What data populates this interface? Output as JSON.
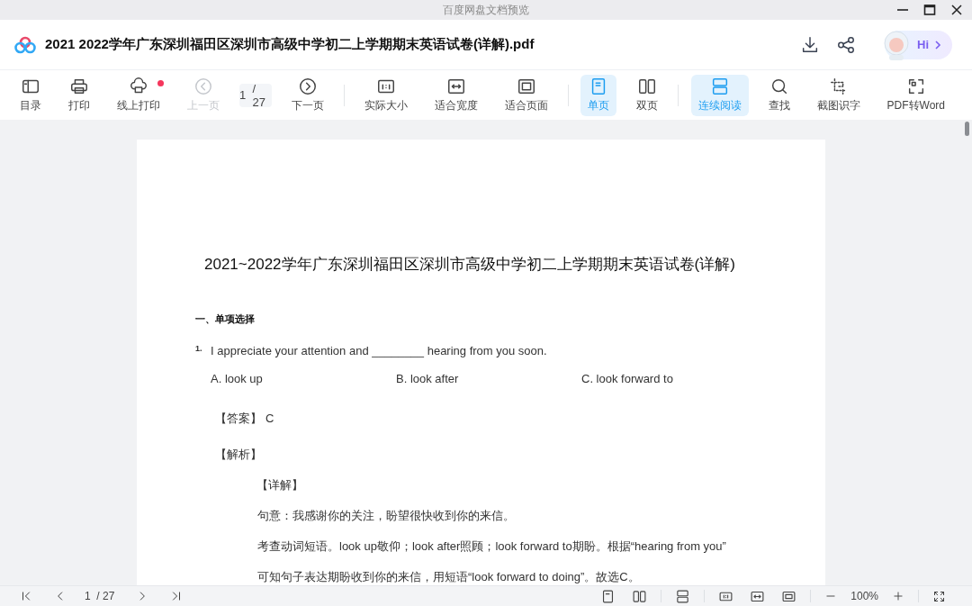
{
  "window": {
    "title": "百度网盘文档预览"
  },
  "header": {
    "file_name": "2021  2022学年广东深圳福田区深圳市高级中学初二上学期期末英语试卷(详解).pdf",
    "assistant_label": "Hi"
  },
  "toolbar": {
    "groups": [
      [
        {
          "kind": "button",
          "label": "目录",
          "selected": false,
          "disabled": false,
          "notification": false
        },
        {
          "kind": "button",
          "label": "打印",
          "selected": false,
          "disabled": false,
          "notification": false
        },
        {
          "kind": "button",
          "label": "线上打印",
          "selected": false,
          "disabled": false,
          "notification": true
        },
        {
          "kind": "button",
          "label": "上一页",
          "selected": false,
          "disabled": true,
          "notification": false
        },
        {
          "kind": "page_field",
          "value": "1",
          "total": "/ 27"
        },
        {
          "kind": "button",
          "label": "下一页",
          "selected": false,
          "disabled": false,
          "notification": false
        }
      ],
      [
        {
          "kind": "button",
          "label": "实际大小",
          "selected": false,
          "disabled": false,
          "notification": false
        },
        {
          "kind": "button",
          "label": "适合宽度",
          "selected": false,
          "disabled": false,
          "notification": false
        },
        {
          "kind": "button",
          "label": "适合页面",
          "selected": false,
          "disabled": false,
          "notification": false
        }
      ],
      [
        {
          "kind": "button",
          "label": "单页",
          "selected": true,
          "disabled": false,
          "notification": false
        },
        {
          "kind": "button",
          "label": "双页",
          "selected": false,
          "disabled": false,
          "notification": false
        }
      ],
      [
        {
          "kind": "button",
          "label": "连续阅读",
          "selected": true,
          "disabled": false,
          "notification": false
        },
        {
          "kind": "button",
          "label": "查找",
          "selected": false,
          "disabled": false,
          "notification": false
        },
        {
          "kind": "button",
          "label": "截图识字",
          "selected": false,
          "disabled": false,
          "notification": false
        },
        {
          "kind": "button",
          "label": "PDF转Word",
          "selected": false,
          "disabled": false,
          "notification": false
        }
      ]
    ]
  },
  "document": {
    "title": "2021~2022学年广东深圳福田区深圳市高级中学初二上学期期末英语试卷(详解)",
    "section": "一、单项选择",
    "question": {
      "number": "1.",
      "text": "I appreciate your attention and ________ hearing from you soon.",
      "options": [
        "A. look up",
        "B. look after",
        "C. look forward to"
      ]
    },
    "answer_label": "【答案】",
    "answer": "C",
    "analysis_label": "【解析】",
    "detail_label": "【详解】",
    "lines": [
      "句意：我感谢你的关注，盼望很快收到你的来信。",
      "考查动词短语。look up敬仰；look after照顾；look forward to期盼。根据“hearing from you”",
      "可知句子表达期盼收到你的来信，用短语“look forward to doing”。故选C。"
    ]
  },
  "status_bar": {
    "page": "1",
    "total": "/ 27",
    "zoom": "100%"
  }
}
